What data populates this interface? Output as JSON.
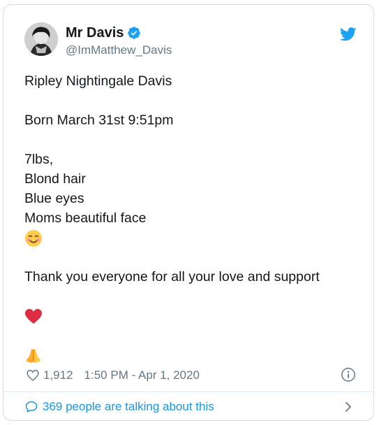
{
  "author": {
    "name": "Mr Davis",
    "handle": "@ImMatthew_Davis",
    "verified": true
  },
  "tweet": {
    "lines": [
      "Ripley Nightingale Davis",
      "Born March 31st 9:51pm",
      "7lbs,",
      "Blond hair",
      "Blue eyes",
      "Moms beautiful face",
      "Thank you everyone for all your love and support"
    ],
    "emojis": [
      "smiling-face-with-blush-emoji",
      "red-heart-emoji",
      "folded-hands-emoji"
    ]
  },
  "meta": {
    "likes": "1,912",
    "timestamp": "1:50 PM - Apr 1, 2020"
  },
  "footer": {
    "talking": "369 people are talking about this"
  },
  "colors": {
    "accent": "#1da1f2",
    "link": "#1b95e0",
    "text": "#14171a",
    "muted": "#657786",
    "heart": "#e0245e"
  }
}
